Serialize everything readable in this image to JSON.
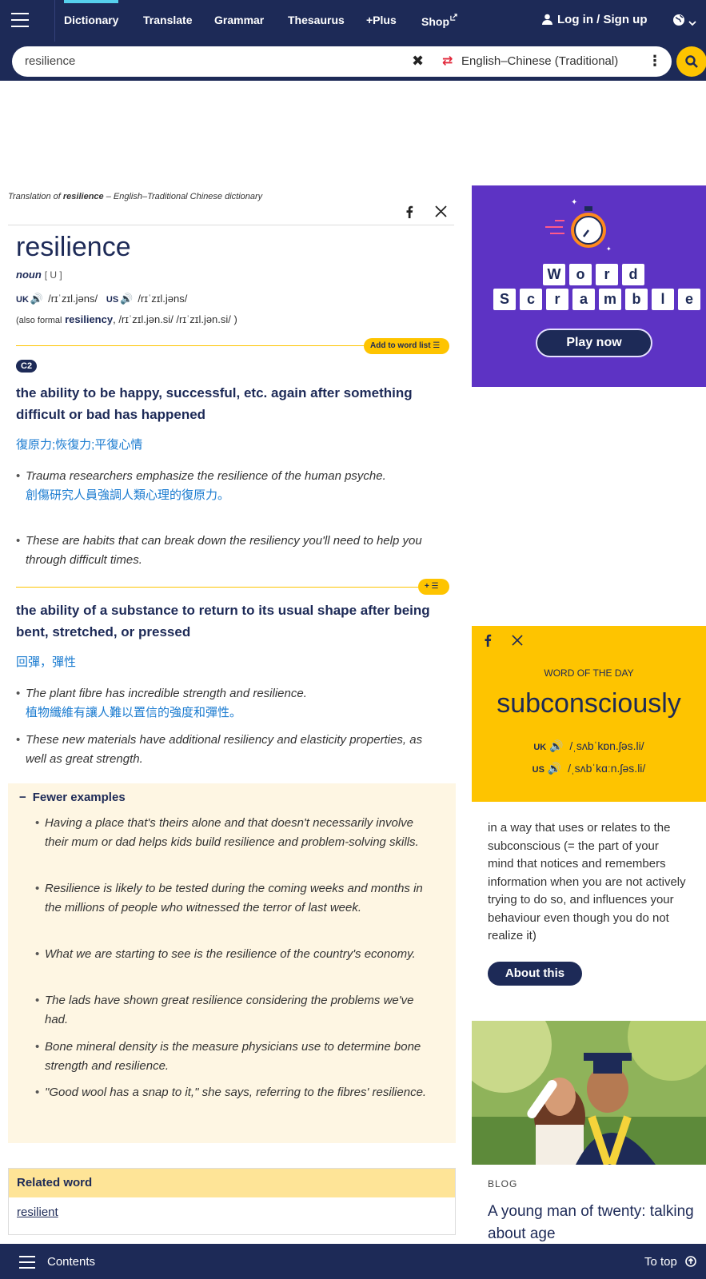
{
  "nav": {
    "items": [
      "Dictionary",
      "Translate",
      "Grammar",
      "Thesaurus",
      "+Plus",
      "Shop"
    ],
    "login": "Log in / Sign up"
  },
  "search": {
    "query": "resilience",
    "language": "English–Chinese (Traditional)"
  },
  "entry": {
    "translation_of_prefix": "Translation of",
    "word_bold": "resilience",
    "dictionary_suffix": "– English–Traditional Chinese dictionary",
    "headword": "resilience",
    "pos": "noun",
    "grammar": "[ U ]",
    "uk_label": "UK",
    "uk_ipa": "/rɪˈzɪl.jəns/",
    "us_label": "US",
    "us_ipa": "/rɪˈzɪl.jəns/",
    "also_prefix": "(also formal",
    "also_word": "resiliency",
    "also_ipa": ", /rɪˈzɪl.jən.si/  /rɪˈzɪl.jən.si/ )",
    "add_to_word_list": "Add to word list",
    "add_short": "+",
    "level": "C2",
    "sense1": {
      "definition": "the ability to be happy, successful, etc. again after something difficult or bad has happened",
      "translation": "復原力;恢復力;平復心情",
      "examples": [
        {
          "en": "Trauma researchers emphasize the resilience of the human psyche.",
          "zh": "創傷研究人員強調人類心理的復原力。"
        },
        {
          "en": "These are habits that can break down the resiliency you'll need to help you through difficult times.",
          "zh": ""
        }
      ]
    },
    "sense2": {
      "definition": "the ability of a substance to return to its usual shape after being bent, stretched, or pressed",
      "translation": "回彈，彈性",
      "examples": [
        {
          "en": "The plant fibre has incredible strength and resilience.",
          "zh": "植物纖維有讓人難以置信的強度和彈性。"
        },
        {
          "en": "These new materials have additional resiliency and elasticity properties, as well as great strength.",
          "zh": ""
        }
      ]
    },
    "fewer_examples": {
      "title": "Fewer examples",
      "items": [
        "Having a place that's theirs alone and that doesn't necessarily involve their mum or dad helps kids build resilience and problem-solving skills.",
        "Resilience is likely to be tested during the coming weeks and months in the millions of people who witnessed the terror of last week.",
        "What we are starting to see is the resilience of the country's economy.",
        "The lads have shown great resilience considering the problems we've had.",
        "Bone mineral density is the measure physicians use to determine bone strength and resilience.",
        "\"Good wool has a snap to it,\" she says, referring to the fibres' resilience."
      ]
    },
    "related": {
      "title": "Related word",
      "word": "resilient"
    }
  },
  "ad": {
    "row1": [
      "W",
      "o",
      "r",
      "d"
    ],
    "row2": [
      "S",
      "c",
      "r",
      "a",
      "m",
      "b",
      "l",
      "e"
    ],
    "button": "Play now"
  },
  "wotd": {
    "label": "WORD OF THE DAY",
    "word": "subconsciously",
    "uk_label": "UK",
    "uk_ipa": "/ˌsʌbˈkɒn.ʃəs.li/",
    "us_label": "US",
    "us_ipa": "/ˌsʌbˈkɑːn.ʃəs.li/",
    "definition": "in a way that uses or relates to the subconscious (= the part of your mind that notices and remembers information when you are not actively trying to do so, and influences your behaviour even though you do not realize it)",
    "about": "About this"
  },
  "blog": {
    "label": "BLOG",
    "title": "A young man of twenty: talking about age"
  },
  "footer": {
    "contents": "Contents",
    "totop": "To top"
  }
}
